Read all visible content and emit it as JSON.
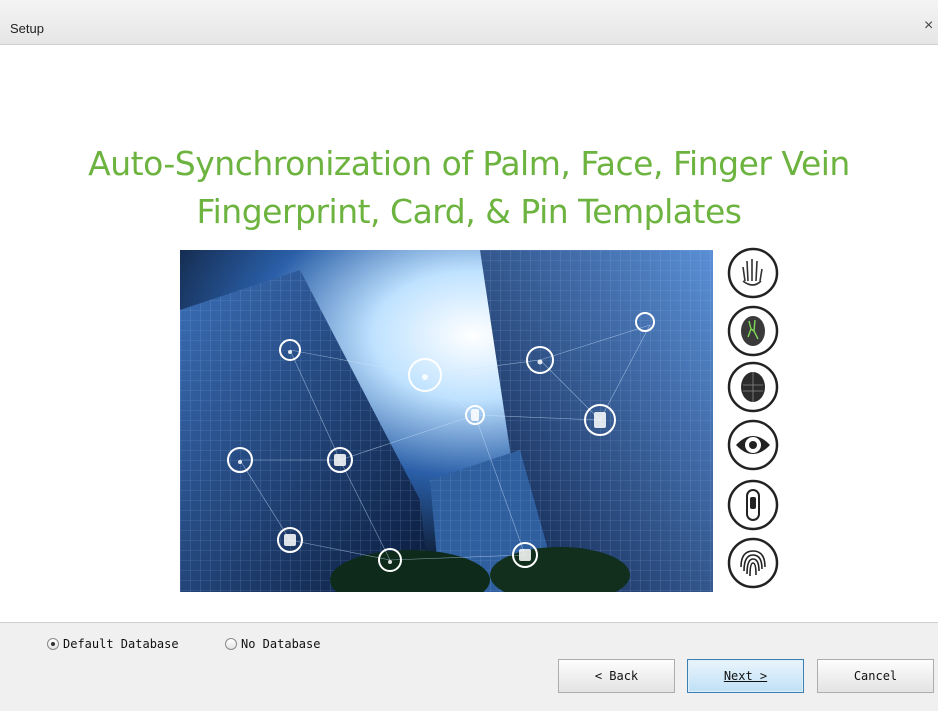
{
  "window": {
    "title": "Setup",
    "close_glyph": "×"
  },
  "headline": {
    "line1": "Auto-Synchronization of Palm, Face, Finger Vein",
    "line2": "Fingerprint, Card, & Pin Templates"
  },
  "biometric_icons": [
    "palm-icon",
    "finger-vein-icon",
    "face-icon",
    "iris-icon",
    "finger-icon",
    "fingerprint-icon"
  ],
  "database_options": [
    {
      "label": "Default Database",
      "selected": true
    },
    {
      "label": "No Database",
      "selected": false
    }
  ],
  "buttons": {
    "back": "< Back",
    "next": "Next >",
    "cancel": "Cancel"
  },
  "colors": {
    "headline": "#6cb33f",
    "next_button": "#bfe0f6"
  }
}
